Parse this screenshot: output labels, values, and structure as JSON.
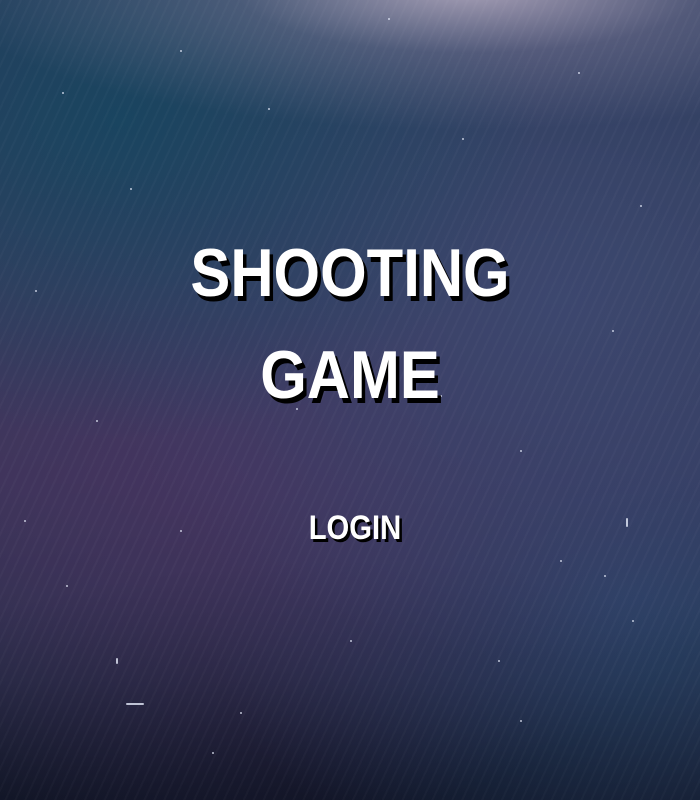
{
  "title": {
    "line1": "SHOOTING",
    "line2": "GAME"
  },
  "menu": {
    "login_label": "LOGIN"
  }
}
